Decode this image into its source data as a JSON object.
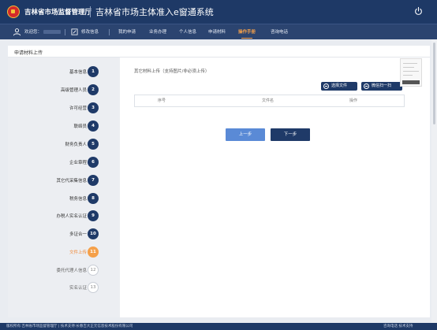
{
  "header": {
    "org_name": "吉林省市场监督管理厅",
    "system_title": "吉林省市场主体准入e窗通系统",
    "brand_color": "#1e3966",
    "accent_color": "#f5a04a",
    "icons": [
      "emblem",
      "power-icon"
    ]
  },
  "nav": {
    "welcome": "欢迎您：",
    "items": [
      {
        "label": "修改信息"
      },
      {
        "label": "我的申请"
      },
      {
        "label": "业务办理"
      },
      {
        "label": "个人信息"
      },
      {
        "label": "申请材料"
      },
      {
        "label": "操作手册",
        "active": true
      },
      {
        "label": "咨询电话"
      }
    ],
    "icons": [
      "user-icon",
      "edit-icon"
    ]
  },
  "card": {
    "title": "申请材料上传"
  },
  "steps": [
    {
      "label": "基本信息",
      "num": "1",
      "state": "done"
    },
    {
      "label": "高级管理人员",
      "num": "2",
      "state": "done"
    },
    {
      "label": "许可经营",
      "num": "3",
      "state": "done"
    },
    {
      "label": "联络员",
      "num": "4",
      "state": "done"
    },
    {
      "label": "财务负责人",
      "num": "5",
      "state": "done"
    },
    {
      "label": "企业章程",
      "num": "6",
      "state": "done"
    },
    {
      "label": "其它代采集信息",
      "num": "7",
      "state": "done"
    },
    {
      "label": "税务信息",
      "num": "8",
      "state": "done"
    },
    {
      "label": "办税人实名认证",
      "num": "9",
      "state": "done"
    },
    {
      "label": "多证合一",
      "num": "10",
      "state": "done"
    },
    {
      "label": "文件上传",
      "num": "11",
      "state": "current"
    },
    {
      "label": "委托代理人信息",
      "num": "12",
      "state": "pending"
    },
    {
      "label": "实名认证",
      "num": "13",
      "state": "pending"
    }
  ],
  "upload": {
    "title": "其它材料上传（支持图片/非必须上传）",
    "select_file": "选择文件",
    "scan_upload": "微信扫一扫",
    "columns": [
      "序号",
      "文件名",
      "操作"
    ]
  },
  "buttons": {
    "prev": "上一步",
    "next": "下一步"
  },
  "footer": {
    "left": "版权所有:吉林省市场监督管理厅 | 技术支持:长春吉大正元信息技术股份有限公司",
    "right": "咨询电话 技术支持"
  }
}
